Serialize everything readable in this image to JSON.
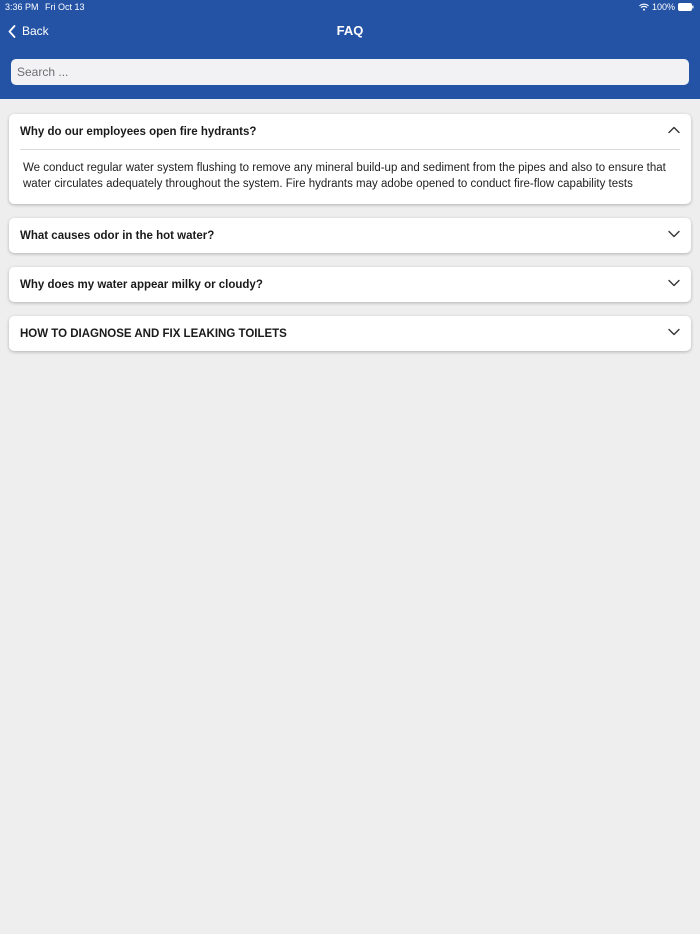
{
  "status_bar": {
    "time": "3:36 PM",
    "date": "Fri Oct 13",
    "battery": "100%"
  },
  "nav": {
    "back_label": "Back",
    "title": "FAQ"
  },
  "search": {
    "placeholder": "Search ..."
  },
  "faq": [
    {
      "question": "Why do our employees open fire hydrants?",
      "expanded": true,
      "answer": "We conduct regular water system flushing to remove any mineral build-up and sediment from the pipes and also to ensure that water circulates adequately throughout the system.  Fire hydrants may adobe opened to conduct fire-flow capability tests"
    },
    {
      "question": "What causes odor in the hot water?",
      "expanded": false
    },
    {
      "question": "Why does my water appear milky or cloudy?",
      "expanded": false
    },
    {
      "question": "HOW TO DIAGNOSE AND FIX LEAKING TOILETS",
      "expanded": false
    }
  ],
  "colors": {
    "header": "#2453a6",
    "background": "#eeeeee"
  }
}
